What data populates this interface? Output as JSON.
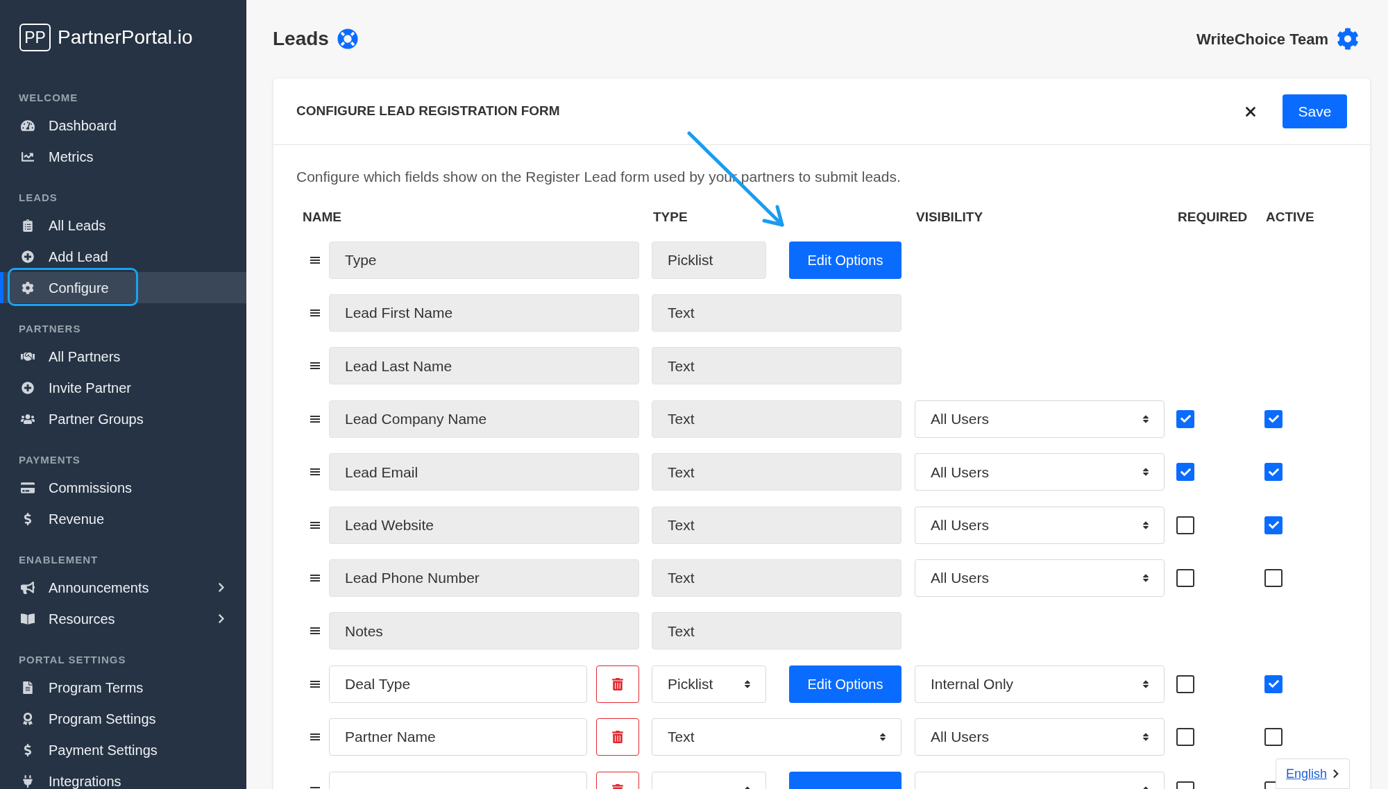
{
  "sidebar": {
    "logo_mark": "PP",
    "brand": "PartnerPortal.io",
    "sections": [
      {
        "heading": "WELCOME",
        "items": [
          {
            "label": "Dashboard",
            "selected": false,
            "has_submenu": false
          },
          {
            "label": "Metrics",
            "selected": false,
            "has_submenu": false
          }
        ]
      },
      {
        "heading": "LEADS",
        "items": [
          {
            "label": "All Leads",
            "selected": false,
            "has_submenu": false
          },
          {
            "label": "Add Lead",
            "selected": false,
            "has_submenu": false
          },
          {
            "label": "Configure",
            "selected": true,
            "has_submenu": false
          }
        ]
      },
      {
        "heading": "PARTNERS",
        "items": [
          {
            "label": "All Partners",
            "selected": false,
            "has_submenu": false
          },
          {
            "label": "Invite Partner",
            "selected": false,
            "has_submenu": false
          },
          {
            "label": "Partner Groups",
            "selected": false,
            "has_submenu": false
          }
        ]
      },
      {
        "heading": "PAYMENTS",
        "items": [
          {
            "label": "Commissions",
            "selected": false,
            "has_submenu": false
          },
          {
            "label": "Revenue",
            "selected": false,
            "has_submenu": false
          }
        ]
      },
      {
        "heading": "ENABLEMENT",
        "items": [
          {
            "label": "Announcements",
            "selected": false,
            "has_submenu": true
          },
          {
            "label": "Resources",
            "selected": false,
            "has_submenu": true
          }
        ]
      },
      {
        "heading": "PORTAL SETTINGS",
        "items": [
          {
            "label": "Program Terms",
            "selected": false,
            "has_submenu": false
          },
          {
            "label": "Program Settings",
            "selected": false,
            "has_submenu": false
          },
          {
            "label": "Payment Settings",
            "selected": false,
            "has_submenu": false
          },
          {
            "label": "Integrations",
            "selected": false,
            "has_submenu": false
          }
        ]
      }
    ]
  },
  "header": {
    "title": "Leads",
    "team": "WriteChoice Team"
  },
  "form": {
    "title": "CONFIGURE LEAD REGISTRATION FORM",
    "save": "Save",
    "description": "Configure which fields show on the Register Lead form used by your partners to submit leads.",
    "columns": [
      "NAME",
      "TYPE",
      "VISIBILITY",
      "REQUIRED",
      "ACTIVE"
    ],
    "rows": [
      {
        "kind": "fixed",
        "name": "Type",
        "type": "Picklist",
        "edit_button": "Edit Options"
      },
      {
        "kind": "fixed",
        "name": "Lead First Name",
        "type": "Text"
      },
      {
        "kind": "fixed",
        "name": "Lead Last Name",
        "type": "Text"
      },
      {
        "kind": "fixed",
        "name": "Lead Company Name",
        "type": "Text",
        "visibility": "All Users",
        "required": true,
        "active": true
      },
      {
        "kind": "fixed",
        "name": "Lead Email",
        "type": "Text",
        "visibility": "All Users",
        "required": true,
        "active": true
      },
      {
        "kind": "fixed",
        "name": "Lead Website",
        "type": "Text",
        "visibility": "All Users",
        "required": false,
        "active": true
      },
      {
        "kind": "fixed",
        "name": "Lead Phone Number",
        "type": "Text",
        "visibility": "All Users",
        "required": false,
        "active": false
      },
      {
        "kind": "fixed",
        "name": "Notes",
        "type": "Text"
      },
      {
        "kind": "custom",
        "name": "Deal Type",
        "type": "Picklist",
        "edit_button": "Edit Options",
        "visibility": "Internal Only",
        "required": false,
        "active": true
      },
      {
        "kind": "custom",
        "name": "Partner Name",
        "type": "Text",
        "visibility": "All Users",
        "required": false,
        "active": false
      },
      {
        "kind": "custom",
        "narrow_type": true,
        "has_visibility": true,
        "required": false,
        "active": false
      }
    ]
  },
  "language": {
    "label": "English"
  }
}
